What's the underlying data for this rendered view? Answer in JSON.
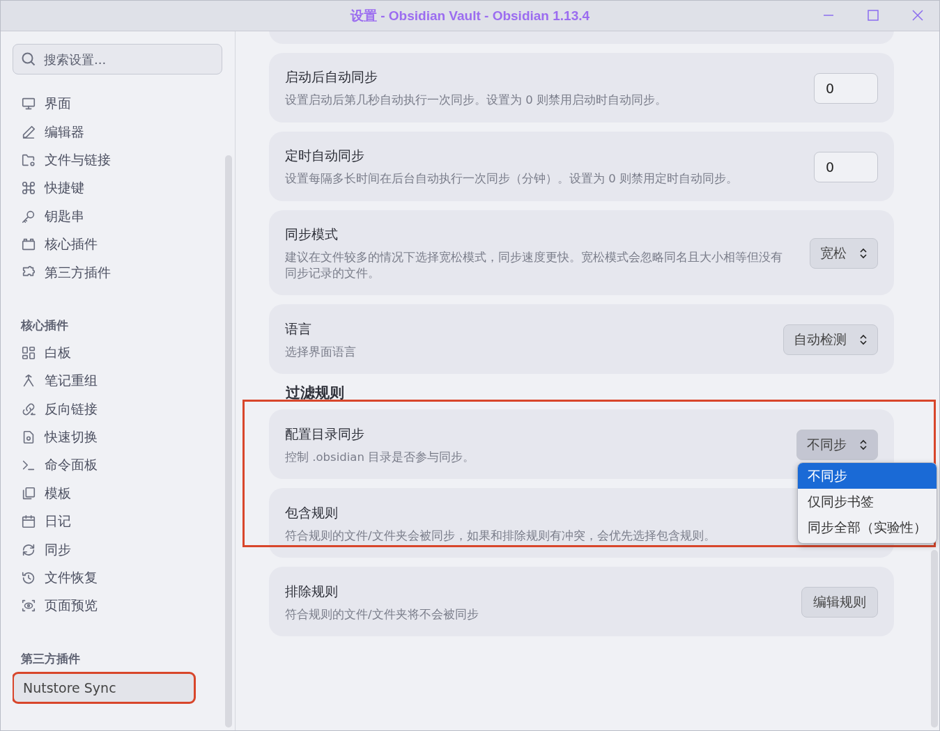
{
  "window": {
    "title": "设置 - Obsidian Vault - Obsidian 1.13.4"
  },
  "sidebar": {
    "search": {
      "placeholder": "搜索设置..."
    },
    "groups": [
      {
        "items": [
          {
            "label": "界面",
            "selected": false
          },
          {
            "label": "编辑器",
            "selected": false
          },
          {
            "label": "文件与链接",
            "selected": false
          },
          {
            "label": "快捷键",
            "selected": false
          },
          {
            "label": "钥匙串",
            "selected": false
          },
          {
            "label": "核心插件",
            "selected": false
          },
          {
            "label": "第三方插件",
            "selected": false
          }
        ]
      },
      {
        "heading": "核心插件",
        "items": [
          {
            "label": "白板",
            "selected": false
          },
          {
            "label": "笔记重组",
            "selected": false
          },
          {
            "label": "反向链接",
            "selected": false
          },
          {
            "label": "快速切换",
            "selected": false
          },
          {
            "label": "命令面板",
            "selected": false
          },
          {
            "label": "模板",
            "selected": false
          },
          {
            "label": "日记",
            "selected": false
          },
          {
            "label": "同步",
            "selected": false
          },
          {
            "label": "文件恢复",
            "selected": false
          },
          {
            "label": "页面预览",
            "selected": false
          }
        ]
      },
      {
        "heading": "第三方插件",
        "items": [
          {
            "label": "Nutstore Sync",
            "selected": true,
            "highlighted": true
          }
        ]
      }
    ]
  },
  "settings": [
    {
      "title": "启动后自动同步",
      "description": "设置启动后第几秒自动执行一次同步。设置为 0 则禁用启动时自动同步。",
      "control": {
        "kind": "input",
        "value": "0"
      }
    },
    {
      "title": "定时自动同步",
      "description": "设置每隔多长时间在后台自动执行一次同步（分钟）。设置为 0 则禁用定时自动同步。",
      "control": {
        "kind": "input",
        "value": "0"
      }
    },
    {
      "title": "同步模式",
      "description": "建议在文件较多的情况下选择宽松模式，同步速度更快。宽松模式会忽略同名且大小相等但没有同步记录的文件。",
      "control": {
        "kind": "select",
        "value": "宽松"
      }
    },
    {
      "title": "语言",
      "description": "选择界面语言",
      "control": {
        "kind": "select",
        "value": "自动检测"
      }
    }
  ],
  "filter_section": {
    "heading": "过滤规则",
    "highlighted": true,
    "settings": [
      {
        "title": "配置目录同步",
        "description": "控制 .obsidian 目录是否参与同步。",
        "control": {
          "kind": "select",
          "value": "不同步",
          "expanded": true,
          "options": [
            {
              "label": "不同步",
              "selected": true
            },
            {
              "label": "仅同步书签",
              "selected": false
            },
            {
              "label": "同步全部（实验性）",
              "selected": false
            }
          ]
        }
      },
      {
        "title": "包含规则",
        "description": "符合规则的文件/文件夹会被同步，如果和排除规则有冲突，会优先选择包含规则。",
        "control": {
          "kind": "hidden"
        }
      },
      {
        "title": "排除规则",
        "description": "符合规则的文件/文件夹将不会被同步",
        "control": {
          "kind": "button",
          "value": "编辑规则"
        }
      }
    ]
  }
}
